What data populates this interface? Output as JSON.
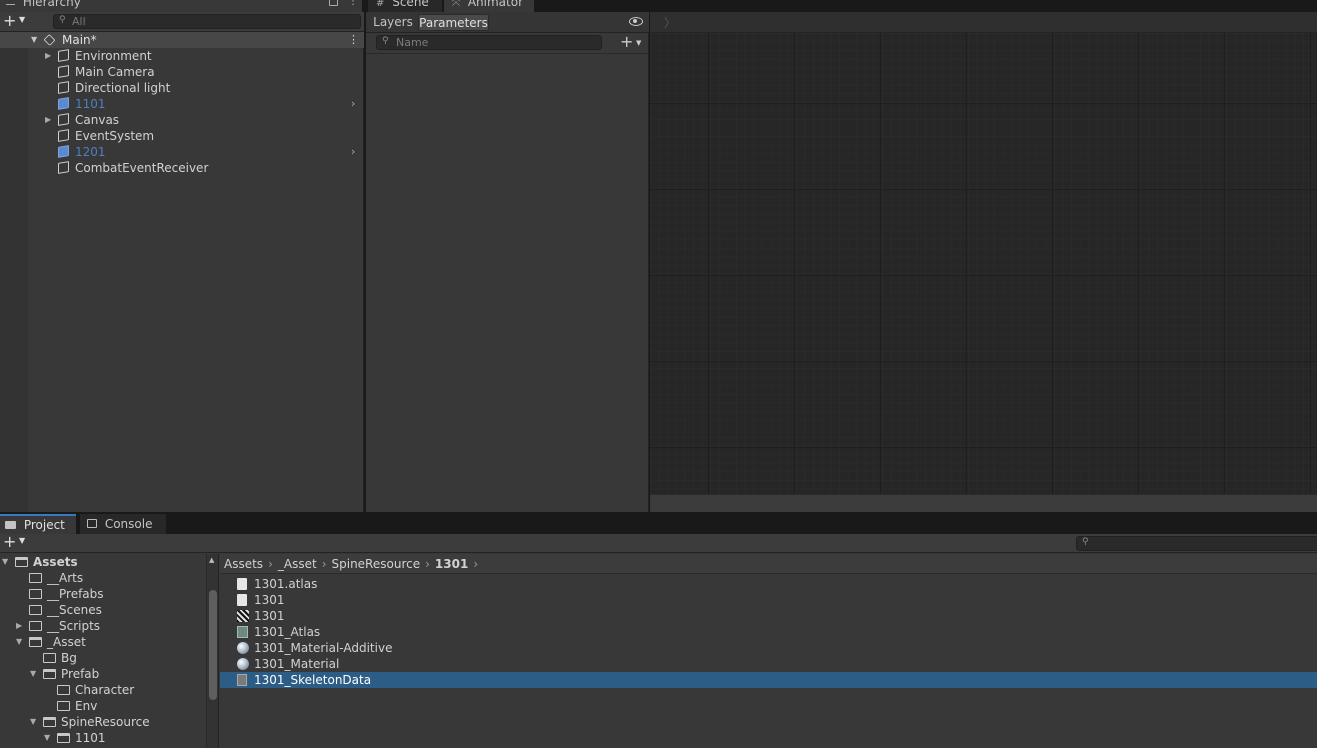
{
  "hierarchy": {
    "tab_label": "Hierarchy",
    "search_placeholder": "All",
    "scene_name": "Main*",
    "items": [
      {
        "label": "Environment",
        "has_children": true,
        "prefab": false
      },
      {
        "label": "Main Camera",
        "has_children": false,
        "prefab": false
      },
      {
        "label": "Directional light",
        "has_children": false,
        "prefab": false
      },
      {
        "label": "1101",
        "has_children": false,
        "prefab": true
      },
      {
        "label": "Canvas",
        "has_children": true,
        "prefab": false
      },
      {
        "label": "EventSystem",
        "has_children": false,
        "prefab": false
      },
      {
        "label": "1201",
        "has_children": false,
        "prefab": true
      },
      {
        "label": "CombatEventReceiver",
        "has_children": false,
        "prefab": false
      }
    ]
  },
  "center_tabs": {
    "scene": "Scene",
    "animator": "Animator"
  },
  "animator": {
    "layers_tab": "Layers",
    "parameters_tab": "Parameters",
    "search_placeholder": "Name"
  },
  "bottom_tabs": {
    "project": "Project",
    "console": "Console"
  },
  "project_tree": [
    {
      "label": "Assets",
      "indent": 0,
      "arrow": "down",
      "open": true,
      "bold": true
    },
    {
      "label": "__Arts",
      "indent": 1,
      "arrow": "",
      "open": false,
      "bold": false
    },
    {
      "label": "__Prefabs",
      "indent": 1,
      "arrow": "",
      "open": false,
      "bold": false
    },
    {
      "label": "__Scenes",
      "indent": 1,
      "arrow": "",
      "open": false,
      "bold": false
    },
    {
      "label": "__Scripts",
      "indent": 1,
      "arrow": "right",
      "open": false,
      "bold": false
    },
    {
      "label": "_Asset",
      "indent": 1,
      "arrow": "down",
      "open": true,
      "bold": false
    },
    {
      "label": "Bg",
      "indent": 2,
      "arrow": "",
      "open": false,
      "bold": false
    },
    {
      "label": "Prefab",
      "indent": 2,
      "arrow": "down",
      "open": true,
      "bold": false
    },
    {
      "label": "Character",
      "indent": 3,
      "arrow": "",
      "open": false,
      "bold": false
    },
    {
      "label": "Env",
      "indent": 3,
      "arrow": "",
      "open": false,
      "bold": false
    },
    {
      "label": "SpineResource",
      "indent": 2,
      "arrow": "down",
      "open": true,
      "bold": false
    },
    {
      "label": "1101",
      "indent": 3,
      "arrow": "down",
      "open": true,
      "bold": false
    }
  ],
  "breadcrumb": [
    "Assets",
    "_Asset",
    "SpineResource",
    "1301"
  ],
  "files": [
    {
      "label": "1301.atlas",
      "icon": "text-file-icon",
      "selected": false
    },
    {
      "label": "1301",
      "icon": "text-file-icon",
      "selected": false
    },
    {
      "label": "1301",
      "icon": "texture-icon",
      "selected": false
    },
    {
      "label": "1301_Atlas",
      "icon": "atlas-asset-icon",
      "selected": false
    },
    {
      "label": "1301_Material-Additive",
      "icon": "material-icon",
      "selected": false
    },
    {
      "label": "1301_Material",
      "icon": "material-icon",
      "selected": false
    },
    {
      "label": "1301_SkeletonData",
      "icon": "skeleton-data-icon",
      "selected": true
    }
  ],
  "colors": {
    "selection": "#2c5d87",
    "prefab_text": "#4f7fc2",
    "panel_bg": "#383838",
    "header_bg": "#282828"
  }
}
